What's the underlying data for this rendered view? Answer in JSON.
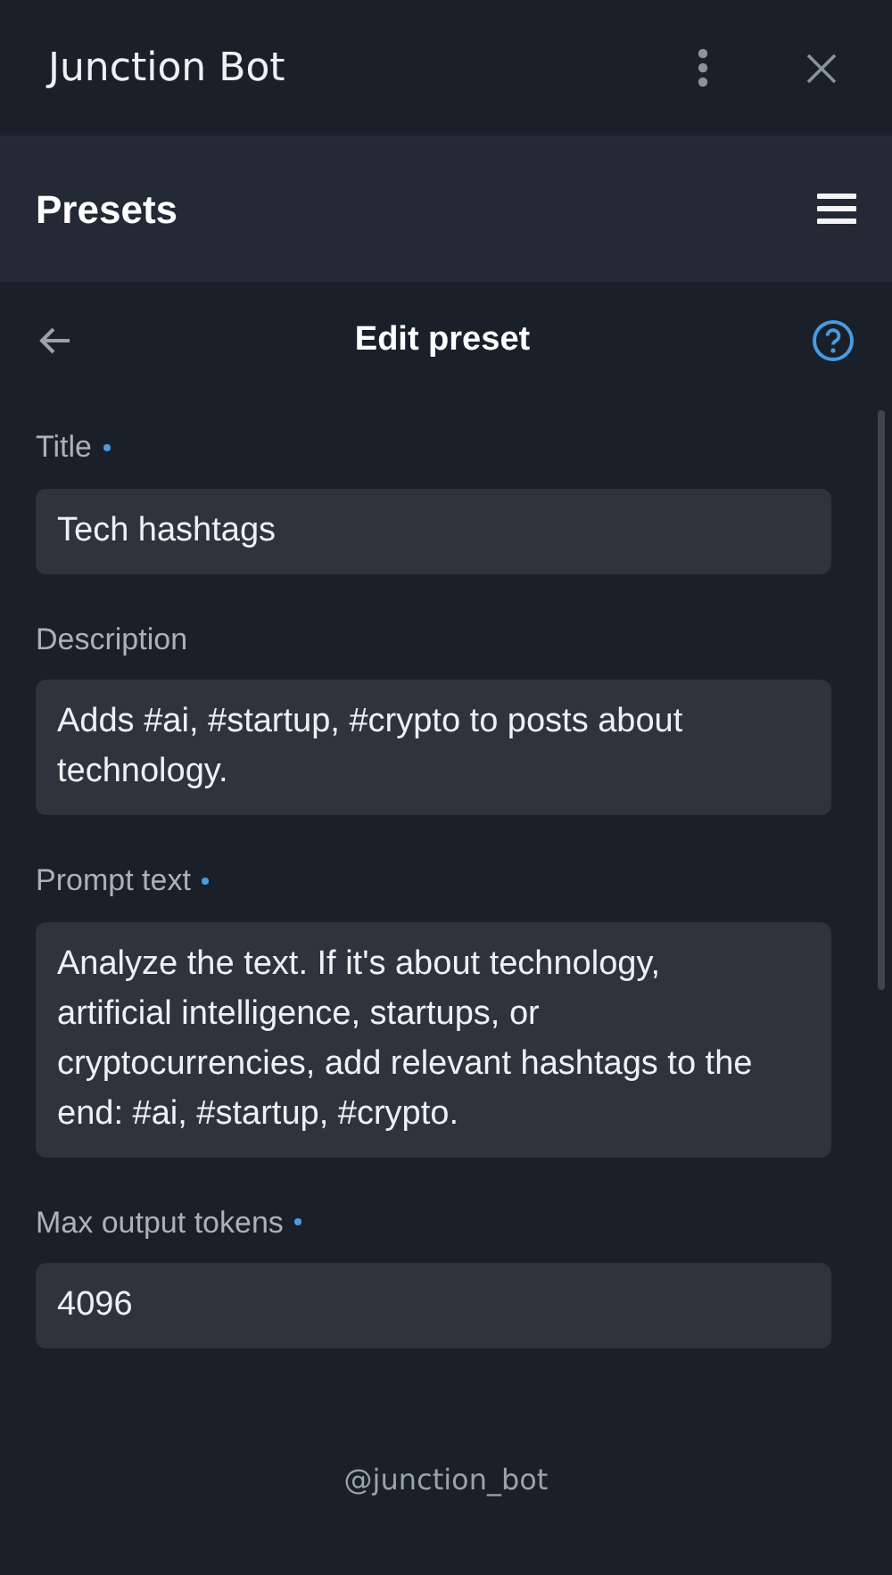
{
  "window": {
    "title": "Junction Bot"
  },
  "section_bar": {
    "title": "Presets"
  },
  "page_header": {
    "title": "Edit preset"
  },
  "fields": [
    {
      "label": "Title",
      "required": true,
      "value": "Tech hashtags"
    },
    {
      "label": "Description",
      "required": false,
      "value": "Adds #ai, #startup, #crypto to posts about technology."
    },
    {
      "label": "Prompt text",
      "required": true,
      "value": "Analyze the text. If it's about technology, artificial intelligence, startups, or cryptocurrencies, add relevant hashtags to the end: #ai, #startup, #crypto."
    },
    {
      "label": "Max output tokens",
      "required": true,
      "value": "4096"
    }
  ],
  "footer": {
    "text": "@junction_bot"
  }
}
